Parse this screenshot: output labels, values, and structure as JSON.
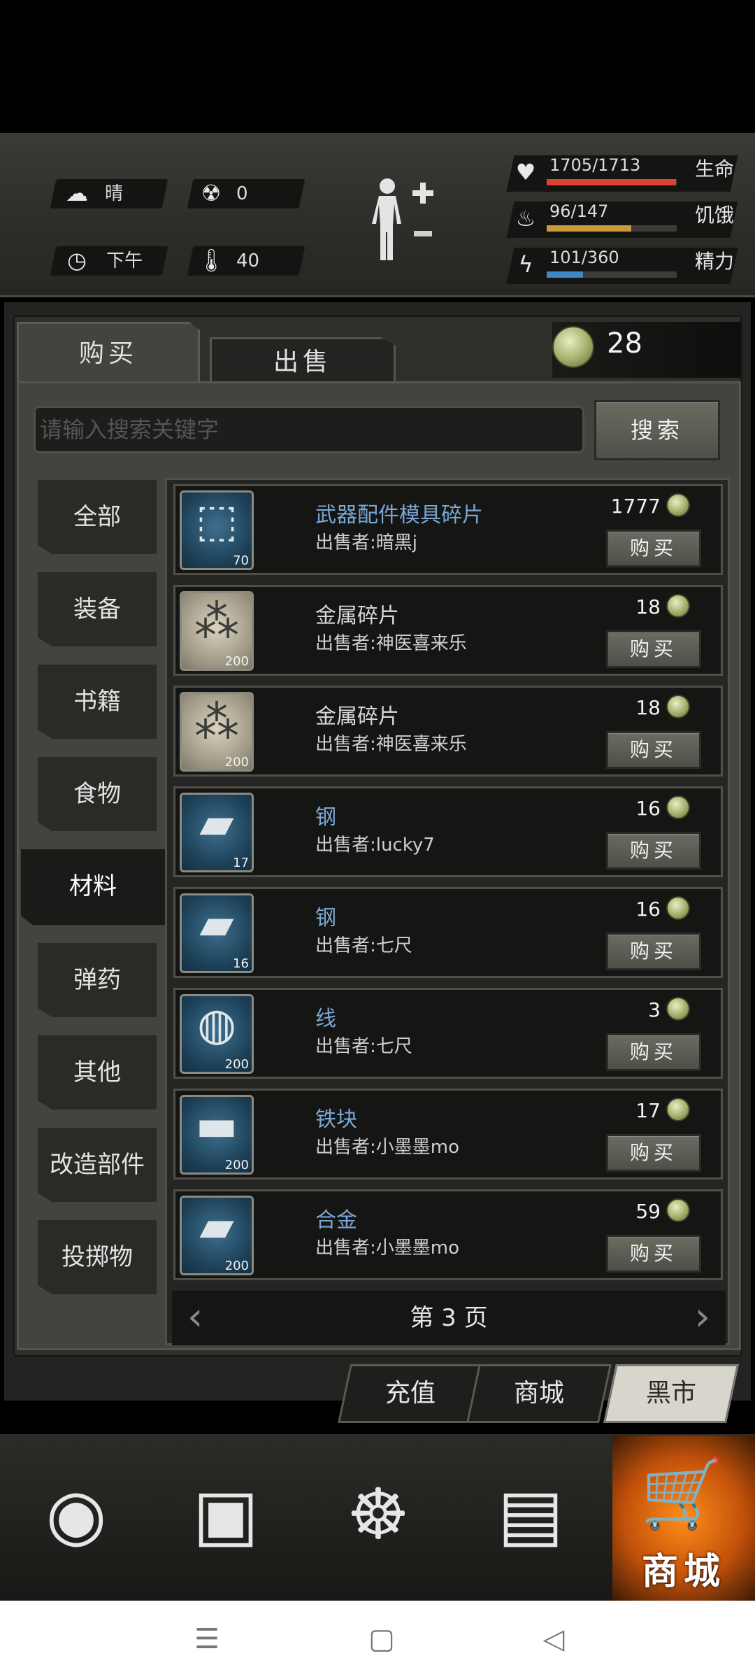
{
  "hud": {
    "weather": "晴",
    "radiation": "0",
    "time": "下午",
    "temperature": "40",
    "stats": [
      {
        "value": "1705/1713",
        "label": "生命",
        "fraction": 0.995,
        "color": "#d9432f"
      },
      {
        "value": "96/147",
        "label": "饥饿",
        "fraction": 0.653,
        "color": "#c99a3c"
      },
      {
        "value": "101/360",
        "label": "精力",
        "fraction": 0.281,
        "color": "#3f86c9"
      }
    ]
  },
  "tabs": {
    "buy": "购买",
    "sell": "出售"
  },
  "coins": "28",
  "search": {
    "placeholder": "请输入搜索关键字",
    "button": "搜索"
  },
  "categories": [
    "全部",
    "装备",
    "书籍",
    "食物",
    "材料",
    "弹药",
    "其他",
    "改造部件",
    "投掷物"
  ],
  "items": [
    {
      "name": "武器配件模具碎片",
      "seller": "出售者:暗黑j",
      "price": "1777",
      "qty": "70",
      "icon": "mold-fragment-icon",
      "bg": "blue",
      "color": "blue"
    },
    {
      "name": "金属碎片",
      "seller": "出售者:神医喜来乐",
      "price": "18",
      "qty": "200",
      "icon": "metal-scrap-icon",
      "bg": "tan",
      "color": "white"
    },
    {
      "name": "金属碎片",
      "seller": "出售者:神医喜来乐",
      "price": "18",
      "qty": "200",
      "icon": "metal-scrap-icon",
      "bg": "tan",
      "color": "white"
    },
    {
      "name": "钢",
      "seller": "出售者:lucky7",
      "price": "16",
      "qty": "17",
      "icon": "steel-plate-icon",
      "bg": "blue",
      "color": "blue"
    },
    {
      "name": "钢",
      "seller": "出售者:七尺",
      "price": "16",
      "qty": "16",
      "icon": "steel-plate-icon",
      "bg": "blue",
      "color": "blue"
    },
    {
      "name": "线",
      "seller": "出售者:七尺",
      "price": "3",
      "qty": "200",
      "icon": "thread-ball-icon",
      "bg": "blue",
      "color": "blue"
    },
    {
      "name": "铁块",
      "seller": "出售者:小墨墨mo",
      "price": "17",
      "qty": "200",
      "icon": "iron-block-icon",
      "bg": "blue",
      "color": "blue"
    },
    {
      "name": "合金",
      "seller": "出售者:小墨墨mo",
      "price": "59",
      "qty": "200",
      "icon": "alloy-bar-icon",
      "bg": "blue",
      "color": "blue"
    }
  ],
  "buy_label": "购买",
  "pager": "第 3 页",
  "bottom_tabs": [
    "充值",
    "商城",
    "黑市"
  ],
  "nav": {
    "shop_label": "商城"
  }
}
